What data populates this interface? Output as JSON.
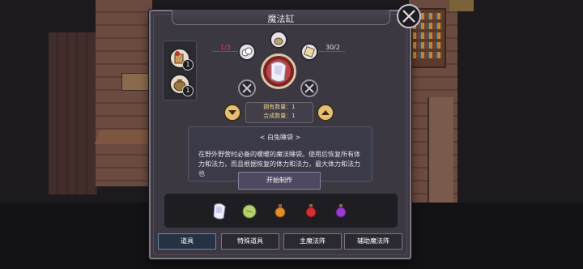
{
  "dialog": {
    "title": "魔法缸"
  },
  "ingredients": [
    {
      "icon": "scroll-bundle-icon",
      "count": "1"
    },
    {
      "icon": "pouch-icon",
      "count": "1"
    }
  ],
  "craft": {
    "left_ratio": "1/3",
    "right_ratio": "30/2",
    "owned_label": "拥有数量：1",
    "craft_label": "合成数量：1",
    "nodes": [
      "cotton-icon",
      "pot-icon",
      "paper-icon",
      "locked-icon",
      "locked-icon"
    ],
    "center_icon": "sleeping-bag-icon"
  },
  "description": {
    "title": "< 白兔睡袋 >",
    "body": "在野外野营时必备的暖暖的魔法睡袋。使用后恢复所有体力和法力，而且根据恢复的体力和法力，最大体力和法力也",
    "start_button": "开始制作"
  },
  "items": [
    {
      "name": "rabbit-sleeping-bag-icon"
    },
    {
      "name": "green-herb-icon"
    },
    {
      "name": "orange-potion-icon"
    },
    {
      "name": "red-potion-icon"
    },
    {
      "name": "purple-potion-icon"
    }
  ],
  "tabs": [
    "道具",
    "特殊道具",
    "主魔法阵",
    "辅助魔法阵"
  ],
  "active_tab": "道具",
  "colors": {
    "panel": "#3b3842",
    "accent_gold": "#e6c070",
    "orb_red": "#c0413f",
    "count_text": "#e8d088"
  }
}
